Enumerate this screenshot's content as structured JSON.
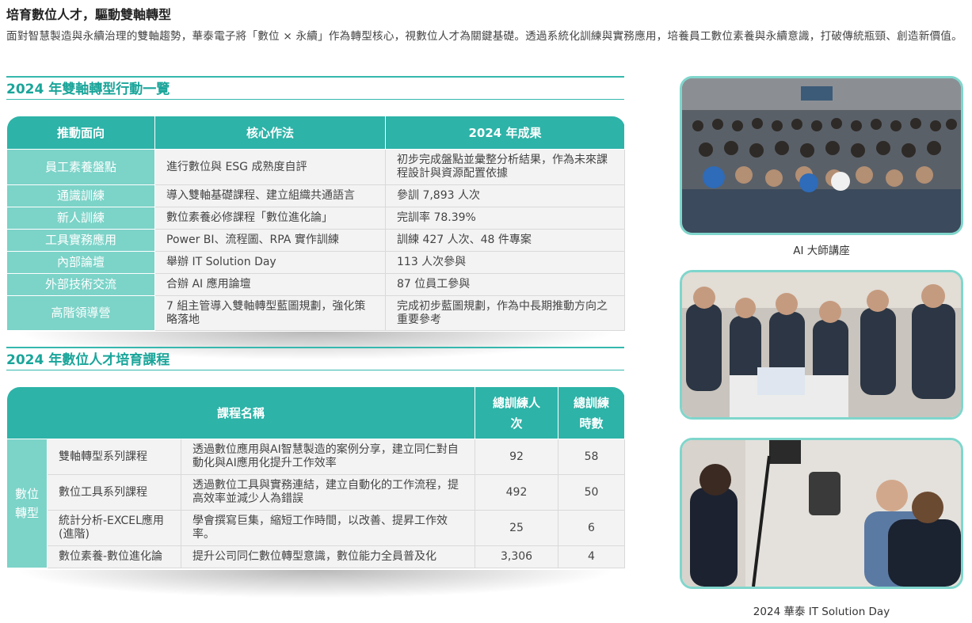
{
  "heading": "培育數位人才，驅動雙軸轉型",
  "intro": "面對智慧製造與永續治理的雙軸趨勢，華泰電子將「數位 × 永續」作為轉型核心，視數位人才為關鍵基礎。透過系統化訓練與實務應用，培養員工數位素養與永續意識，打破傳統瓶頸、創造新價值。",
  "section1": {
    "title": "2024 年雙軸轉型行動一覽",
    "headers": [
      "推動面向",
      "核心作法",
      "2024 年成果"
    ],
    "rows": [
      {
        "area": "員工素養盤點",
        "method": "進行數位與 ESG 成熟度自評",
        "result": "初步完成盤點並彙整分析結果，作為未來課程設計與資源配置依據"
      },
      {
        "area": "通識訓練",
        "method": "導入雙軸基礎課程、建立組織共通語言",
        "result": "參訓 7,893 人次"
      },
      {
        "area": "新人訓練",
        "method": "數位素養必修課程「數位進化論」",
        "result": "完訓率 78.39%"
      },
      {
        "area": "工具實務應用",
        "method": "Power BI、流程圖、RPA 實作訓練",
        "result": "訓練 427 人次、48 件專案"
      },
      {
        "area": "內部論壇",
        "method": "舉辦 IT Solution Day",
        "result": "113 人次參與"
      },
      {
        "area": "外部技術交流",
        "method": "合辦 AI 應用論壇",
        "result": "87 位員工參與"
      },
      {
        "area": "高階領導營",
        "method": "7 組主管導入雙軸轉型藍圖規劃，強化策略落地",
        "result": "完成初步藍圖規劃，作為中長期推動方向之重要參考"
      }
    ]
  },
  "section2": {
    "title": "2024 年數位人才培育課程",
    "headers": {
      "course": "課程名稱",
      "people": "總訓練人次",
      "hours": "總訓練時數"
    },
    "category": "數位轉型",
    "rows": [
      {
        "name": "雙軸轉型系列課程",
        "desc": "透過數位應用與AI智慧製造的案例分享，建立同仁對自動化與AI應用化提升工作效率",
        "people": "92",
        "hours": "58"
      },
      {
        "name": "數位工具系列課程",
        "desc": "透過數位工具與實務連結，建立自動化的工作流程，提高效率並減少人為錯誤",
        "people": "492",
        "hours": "50"
      },
      {
        "name": "統計分析-EXCEL應用(進階)",
        "desc": "學會撰寫巨集，縮短工作時間，以改善、提昇工作效率。",
        "people": "25",
        "hours": "6"
      },
      {
        "name": "數位素養-數位進化論",
        "desc": "提升公司同仁數位轉型意識，數位能力全員普及化",
        "people": "3,306",
        "hours": "4"
      }
    ]
  },
  "photos": {
    "caption1": "AI 大師講座",
    "caption3": "2024 華泰 IT Solution Day"
  },
  "colors": {
    "accent": "#2db3a8",
    "mint": "#7cd3c8",
    "title": "#1aa59a"
  }
}
